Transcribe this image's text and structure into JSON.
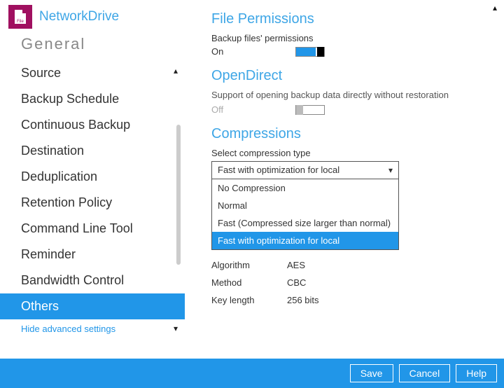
{
  "brand": {
    "title": "NetworkDrive",
    "icon_label": "File"
  },
  "sidebar": {
    "items": [
      {
        "label": "General"
      },
      {
        "label": "Source"
      },
      {
        "label": "Backup Schedule"
      },
      {
        "label": "Continuous Backup"
      },
      {
        "label": "Destination"
      },
      {
        "label": "Deduplication"
      },
      {
        "label": "Retention Policy"
      },
      {
        "label": "Command Line Tool"
      },
      {
        "label": "Reminder"
      },
      {
        "label": "Bandwidth Control"
      },
      {
        "label": "Others"
      }
    ],
    "hide_advanced": "Hide advanced settings"
  },
  "content": {
    "file_permissions": {
      "title": "File Permissions",
      "desc": "Backup files' permissions",
      "state_label": "On"
    },
    "open_direct": {
      "title": "OpenDirect",
      "desc": "Support of opening backup data directly without restoration",
      "state_label": "Off"
    },
    "compressions": {
      "title": "Compressions",
      "label": "Select compression type",
      "selected": "Fast with optimization for local",
      "options": [
        "No Compression",
        "Normal",
        "Fast (Compressed size larger than normal)",
        "Fast with optimization for local"
      ]
    },
    "encryption": {
      "algorithm_key": "Algorithm",
      "algorithm_val": "AES",
      "method_key": "Method",
      "method_val": "CBC",
      "keylen_key": "Key length",
      "keylen_val": "256 bits"
    }
  },
  "footer": {
    "save": "Save",
    "cancel": "Cancel",
    "help": "Help"
  }
}
